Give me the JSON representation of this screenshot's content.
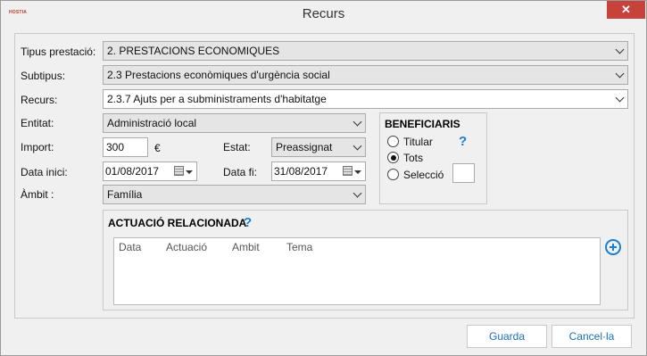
{
  "window": {
    "title": "Recurs",
    "app_logo": "HOSTIA",
    "close_label": "✕"
  },
  "form": {
    "tipus_prestacio": {
      "label": "Tipus prestació:",
      "value": "2. PRESTACIONS ECONOMIQUES"
    },
    "subtipus": {
      "label": "Subtipus:",
      "value": "2.3 Prestacions econòmiques d'urgència social"
    },
    "recurs": {
      "label": "Recurs:",
      "value": "2.3.7 Ajuts per a subministraments d'habitatge"
    },
    "entitat": {
      "label": "Entitat:",
      "value": "Administració local"
    },
    "import": {
      "label": "Import:",
      "value": "300",
      "currency": "€"
    },
    "estat": {
      "label": "Estat:",
      "value": "Preassignat"
    },
    "data_inici": {
      "label": "Data inici:",
      "value": "01/08/2017"
    },
    "data_fi": {
      "label": "Data fi:",
      "value": "31/08/2017"
    },
    "ambit": {
      "label": "Àmbit :",
      "value": "Família"
    }
  },
  "beneficiaris": {
    "title": "BENEFICIARIS",
    "options": [
      {
        "label": "Titular",
        "selected": false
      },
      {
        "label": "Tots",
        "selected": true
      },
      {
        "label": "Selecció",
        "selected": false
      }
    ],
    "help": "?"
  },
  "actuacio": {
    "title": "ACTUACIÓ RELACIONADA",
    "help": "?",
    "columns": [
      "Data",
      "Actuació",
      "Ambit",
      "Tema"
    ]
  },
  "buttons": {
    "save": "Guarda",
    "cancel": "Cancel·la"
  },
  "colors": {
    "accent": "#1a7fd1",
    "close": "#c7423a"
  }
}
